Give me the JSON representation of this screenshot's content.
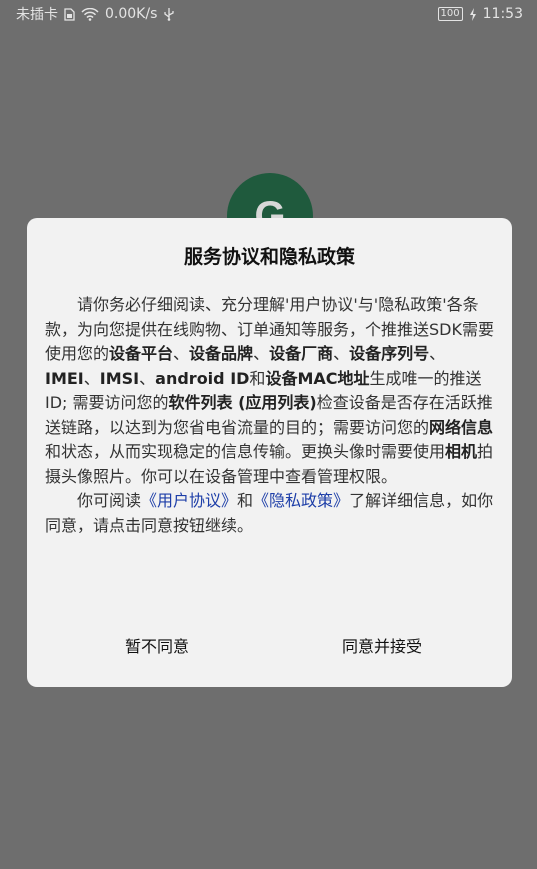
{
  "status_bar": {
    "carrier": "未插卡",
    "speed": "0.00K/s",
    "battery": "100",
    "time": "11:53"
  },
  "logo": {
    "letter": "G",
    "color": "#1f5a3d"
  },
  "dialog": {
    "title": "服务协议和隐私政策",
    "p1": {
      "t1": "请你务必仔细阅读、充分理解'用户协议'与'隐私政策'各条款，为向您提供在线购物、订单通知等服务，个推推送SDK需要使用您的",
      "b1": "设备平台",
      "t2": "、",
      "b2": "设备品牌",
      "t3": "、",
      "b3": "设备厂商",
      "t4": "、",
      "b4": "设备序列号",
      "t5": "、",
      "b5": "IMEI",
      "t6": "、",
      "b6": "IMSI",
      "t7": "、",
      "b7": "android ID",
      "t8": "和",
      "b8": "设备MAC地址",
      "t9": "生成唯一的推送ID; 需要访问您的",
      "b9": "软件列表 (应用列表)",
      "t10": "检查设备是否存在活跃推送链路，以达到为您省电省流量的目的；需要访问您的",
      "b10": "网络信息",
      "t11": "和状态，从而实现稳定的信息传输。更换头像时需要使用",
      "b11": "相机",
      "t12": "拍摄头像照片。你可以在设备管理中查看管理权限。"
    },
    "p2": {
      "t1": "你可阅读",
      "link1": "《用户协议》",
      "t2": "和",
      "link2": "《隐私政策》",
      "t3": "了解详细信息，如你同意，请点击同意按钮继续。"
    },
    "reject_label": "暂不同意",
    "accept_label": "同意并接受"
  }
}
